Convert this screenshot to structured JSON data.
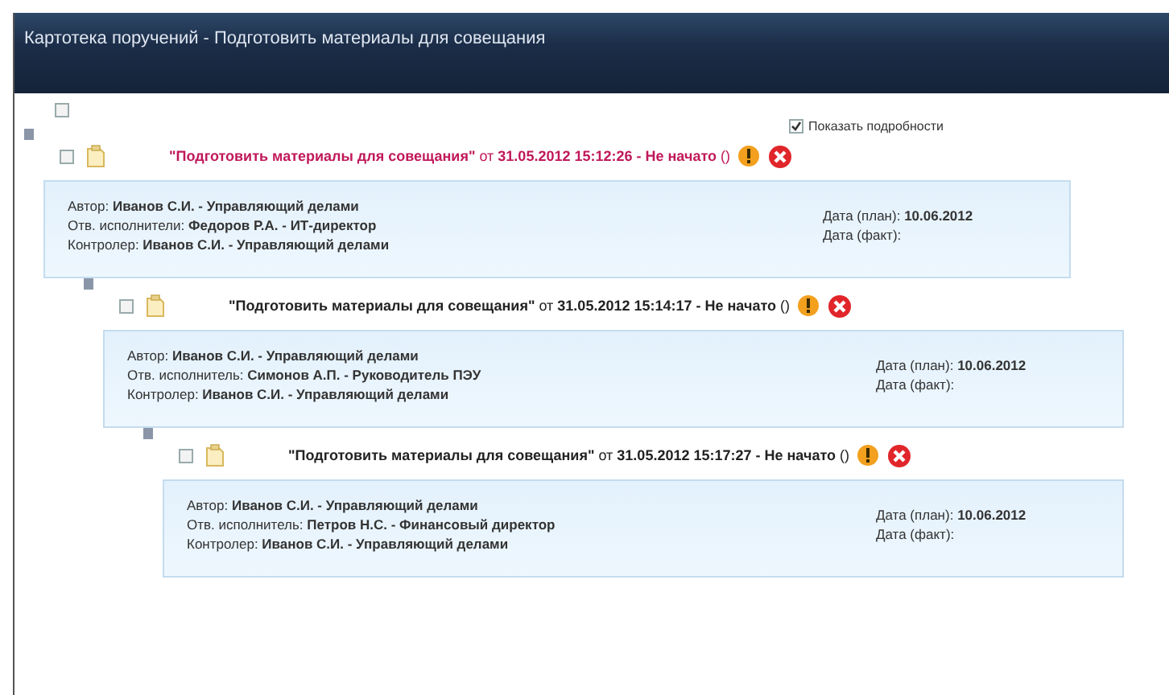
{
  "window": {
    "title": "Картотека поручений - Подготовить материалы для совещания"
  },
  "select_all": {
    "checked": false
  },
  "show_details": {
    "label": "Показать подробности",
    "checked": true
  },
  "items": [
    {
      "expanded": true,
      "checked": false,
      "highlighted": true,
      "title": "**\"Подготовить материалы для совещания\"** от **31.05.2012 15:12:26 - Не начато** ()",
      "details": [
        "Автор: **Иванов С.И. - Управляющий делами**",
        "Отв. исполнители: **Федоров Р.А. - ИТ-директор**",
        "Контролер: **Иванов С.И. - Управляющий делами**"
      ],
      "dates": [
        "Дата (план): **10.06.2012**",
        "Дата (факт):"
      ],
      "children": [
        {
          "expanded": true,
          "checked": false,
          "highlighted": false,
          "title": "**\"Подготовить материалы для совещания\"** от **31.05.2012 15:14:17 - Не начато** ()",
          "details": [
            "Автор: **Иванов С.И. - Управляющий делами**",
            "Отв. исполнитель: **Симонов А.П. - Руководитель ПЭУ**",
            "Контролер: **Иванов С.И. - Управляющий делами**"
          ],
          "dates": [
            "Дата (план): **10.06.2012**",
            "Дата (факт):"
          ],
          "children": [
            {
              "expanded": true,
              "checked": false,
              "highlighted": false,
              "title": "**\"Подготовить материалы для совещания\"** от **31.05.2012 15:17:27 - Не начато** ()",
              "details": [
                "Автор: **Иванов С.И. - Управляющий делами**",
                "Отв. исполнитель: **Петров Н.С. - Финансовый директор**",
                "Контролер: **Иванов С.И. - Управляющий делами**"
              ],
              "dates": [
                "Дата (план): **10.06.2012**",
                "Дата (факт):"
              ]
            }
          ]
        }
      ]
    }
  ]
}
